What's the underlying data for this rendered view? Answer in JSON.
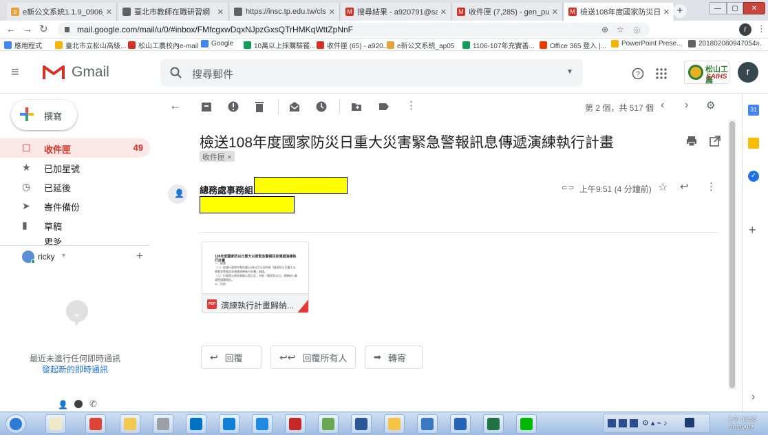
{
  "browser": {
    "tabs": [
      {
        "title": "e新公文系統1.1.9_0906_ap04",
        "fav": "#e8a33d",
        "fav_txt": "e",
        "active": false
      },
      {
        "title": "臺北市教師在職研習網",
        "fav": "#5f6368",
        "fav_txt": "",
        "active": false
      },
      {
        "title": "https://insc.tp.edu.tw/cls/Cls/",
        "fav": "#5f6368",
        "fav_txt": "",
        "active": false
      },
      {
        "title": "搜尋結果 - a920791@saihs.ed",
        "fav": "#d93025",
        "fav_txt": "M",
        "active": false
      },
      {
        "title": "收件匣 (7,285) - gen_pur@saih",
        "fav": "#d93025",
        "fav_txt": "M",
        "active": false
      },
      {
        "title": "檢送108年度國家防災日重大災",
        "fav": "#d93025",
        "fav_txt": "M",
        "active": true
      }
    ],
    "new_tab": "+",
    "url": "mail.google.com/mail/u/0/#inbox/FMfcgxwDqxNJpzGxsQTrHMKqWttZpNnF",
    "profile_initial": "r",
    "bookmarks": [
      {
        "label": "應用程式",
        "color": "#4285f4"
      },
      {
        "label": "臺北市立松山高級...",
        "color": "#f4b400"
      },
      {
        "label": "松山工農校內e-mail",
        "color": "#d93025"
      },
      {
        "label": "Google",
        "color": "#4285f4"
      },
      {
        "label": "10萬以上採購驗罹...",
        "color": "#0f9d58"
      },
      {
        "label": "收件匣 (65) - a920...",
        "color": "#d93025"
      },
      {
        "label": "e新公文系統_ap05",
        "color": "#e8a33d"
      },
      {
        "label": "1106-107年充實善...",
        "color": "#0f9d58"
      },
      {
        "label": "Office 365 登入 |...",
        "color": "#eb3c00"
      },
      {
        "label": "PowerPoint Prese...",
        "color": "#f4b400"
      },
      {
        "label": "201802080947054...",
        "color": "#5f6368"
      }
    ],
    "more_bookmarks": "»"
  },
  "gmail": {
    "logo_text": "Gmail",
    "search_placeholder": "搜尋郵件",
    "account_initial": "r",
    "school_logo_text": "松山工農",
    "school_logo_sub": "SAIHS",
    "compose_label": "撰寫",
    "nav": [
      {
        "label": "收件匣",
        "count": "49",
        "active": true,
        "icon": "inbox-icon"
      },
      {
        "label": "已加星號",
        "count": "",
        "active": false,
        "icon": "star-icon"
      },
      {
        "label": "已延後",
        "count": "",
        "active": false,
        "icon": "clock-icon"
      },
      {
        "label": "寄件備份",
        "count": "",
        "active": false,
        "icon": "send-icon"
      },
      {
        "label": "草稿",
        "count": "",
        "active": false,
        "icon": "draft-icon"
      }
    ],
    "nav_partial": "更多",
    "hangouts_user": "ricky",
    "hangouts_empty": "最近未進行任何即時通訊",
    "hangouts_start": "發起新的即時通訊",
    "pagination": "第 2 個，共 517 個",
    "subject": "檢送108年度國家防災日重大災害緊急警報訊息傳遞演練執行計畫",
    "label_chip": "收件匣",
    "label_chip_x": "×",
    "sender": "總務處事務組",
    "time": "上午9:51 (4 分鐘前)",
    "attachment": {
      "name": "演練執行計畫歸納...",
      "type_badge": "PDF",
      "preview_title": "108年度國家防災日重大災害緊急警報訊息傳遞演練執行計畫",
      "preview_lines": [
        "一、依據",
        "（一）依據行政院中華民國108年8月19日院授「國家防災日重大災害緊急警報訊息傳遞演練執行計畫」辦理。",
        "（二）行政院災害防救辦公室訂定，另依「國家防災日」演練核心事項暨相關規定。",
        "二、目的"
      ]
    },
    "actions": {
      "reply": "回覆",
      "reply_all": "回覆所有人",
      "forward": "轉寄"
    }
  },
  "taskbar": {
    "apps": [
      {
        "name": "start-orb",
        "color": "#2c7bd6"
      },
      {
        "name": "notepad",
        "color": "#f0e9c8"
      },
      {
        "name": "chrome",
        "color": "#db4437"
      },
      {
        "name": "file-explorer",
        "color": "#f2c94c"
      },
      {
        "name": "imx",
        "color": "#9aa0a6"
      },
      {
        "name": "outlook",
        "color": "#0072c6"
      },
      {
        "name": "teamviewer",
        "color": "#0e7fd6"
      },
      {
        "name": "internet-explorer",
        "color": "#1e88e5"
      },
      {
        "name": "avira",
        "color": "#c62828"
      },
      {
        "name": "snipping-tool",
        "color": "#6aa84f"
      },
      {
        "name": "word",
        "color": "#2b579a"
      },
      {
        "name": "paint",
        "color": "#f6c343"
      },
      {
        "name": "remote-desktop",
        "color": "#3a78c3"
      },
      {
        "name": "help",
        "color": "#2563b6"
      },
      {
        "name": "excel",
        "color": "#217346"
      },
      {
        "name": "line",
        "color": "#00b900"
      }
    ],
    "clock_time": "上午 09:55",
    "clock_date": "2019/9/2"
  }
}
